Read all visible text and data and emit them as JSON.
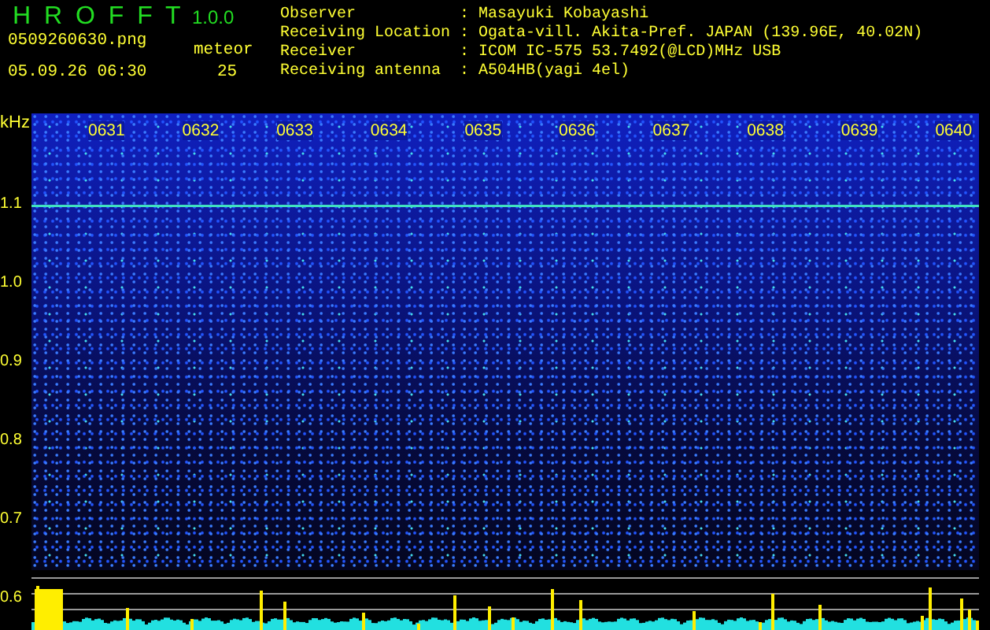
{
  "app": {
    "title": "H R O F F T",
    "version": "1.0.0"
  },
  "file": "0509260630.png",
  "datetime": "05.09.26 06:30",
  "meteor": {
    "label": "meteor",
    "count": "25"
  },
  "info": [
    {
      "label": "Observer",
      "sep": ":",
      "value": "Masayuki Kobayashi"
    },
    {
      "label": "Receiving Location",
      "sep": ":",
      "value": "Ogata-vill. Akita-Pref. JAPAN (139.96E, 40.02N)"
    },
    {
      "label": "Receiver",
      "sep": ":",
      "value": "ICOM IC-575 53.7492(@LCD)MHz USB"
    },
    {
      "label": "Receiving antenna",
      "sep": ":",
      "value": "A504HB(yagi 4el)"
    }
  ],
  "axis": {
    "unit": "kHz",
    "y_labels": [
      "1.1",
      "1.0",
      "0.9",
      "0.8",
      "0.7",
      "0.6"
    ],
    "time_labels": [
      "0631",
      "0632",
      "0633",
      "0634",
      "0635",
      "0636",
      "0637",
      "0638",
      "0639",
      "0640"
    ]
  }
}
